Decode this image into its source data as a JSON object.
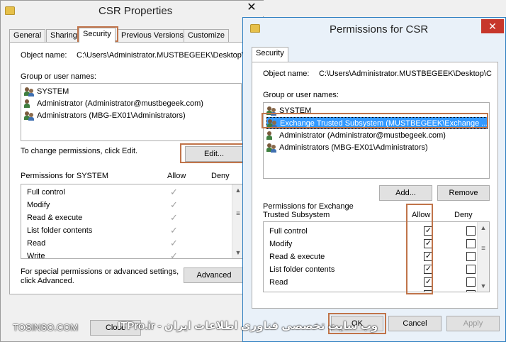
{
  "csr_properties": {
    "title": "CSR Properties",
    "close": "✕",
    "tabs": [
      {
        "label": "General"
      },
      {
        "label": "Sharing"
      },
      {
        "label": "Security"
      },
      {
        "label": "Previous Versions"
      },
      {
        "label": "Customize"
      }
    ],
    "object_name_label": "Object name:",
    "object_name_value": "C:\\Users\\Administrator.MUSTBEGEEK\\Desktop\\",
    "group_label": "Group or user names:",
    "users": [
      {
        "name": "SYSTEM"
      },
      {
        "name": "Administrator (Administrator@mustbegeek.com)"
      },
      {
        "name": "Administrators (MBG-EX01\\Administrators)"
      }
    ],
    "change_text": "To change permissions, click Edit.",
    "edit_button": "Edit...",
    "perm_header": "Permissions for SYSTEM",
    "allow_header": "Allow",
    "deny_header": "Deny",
    "permissions": [
      {
        "name": "Full control"
      },
      {
        "name": "Modify"
      },
      {
        "name": "Read & execute"
      },
      {
        "name": "List folder contents"
      },
      {
        "name": "Read"
      },
      {
        "name": "Write"
      }
    ],
    "special_text_1": "For special permissions or advanced settings,",
    "special_text_2": "click Advanced.",
    "advanced_button": "Advanced",
    "close_button": "Close"
  },
  "permissions_dialog": {
    "title": "Permissions for CSR",
    "close": "✕",
    "tab": "Security",
    "object_name_label": "Object name:",
    "object_name_value": "C:\\Users\\Administrator.MUSTBEGEEK\\Desktop\\C",
    "group_label": "Group or user names:",
    "users": [
      {
        "name": "SYSTEM"
      },
      {
        "name": "Exchange Trusted Subsystem (MUSTBEGEEK\\Exchange ..."
      },
      {
        "name": "Administrator (Administrator@mustbegeek.com)"
      },
      {
        "name": "Administrators (MBG-EX01\\Administrators)"
      }
    ],
    "add_button": "Add...",
    "remove_button": "Remove",
    "perm_header_1": "Permissions for Exchange",
    "perm_header_2": "Trusted Subsystem",
    "allow_header": "Allow",
    "deny_header": "Deny",
    "permissions": [
      {
        "name": "Full control",
        "allow": true,
        "deny": false
      },
      {
        "name": "Modify",
        "allow": true,
        "deny": false
      },
      {
        "name": "Read & execute",
        "allow": true,
        "deny": false
      },
      {
        "name": "List folder contents",
        "allow": true,
        "deny": false
      },
      {
        "name": "Read",
        "allow": true,
        "deny": false
      }
    ],
    "ok_button": "OK",
    "cancel_button": "Cancel",
    "apply_button": "Apply"
  },
  "watermarks": {
    "left": "TOSINSO.COM",
    "right": "ITPro.ir - وب سایت تخصصی فناوری اطلاعات ایران"
  },
  "colors": {
    "highlight_border": "#c0744a",
    "selection": "#3399ff",
    "close_red": "#c7372b"
  }
}
